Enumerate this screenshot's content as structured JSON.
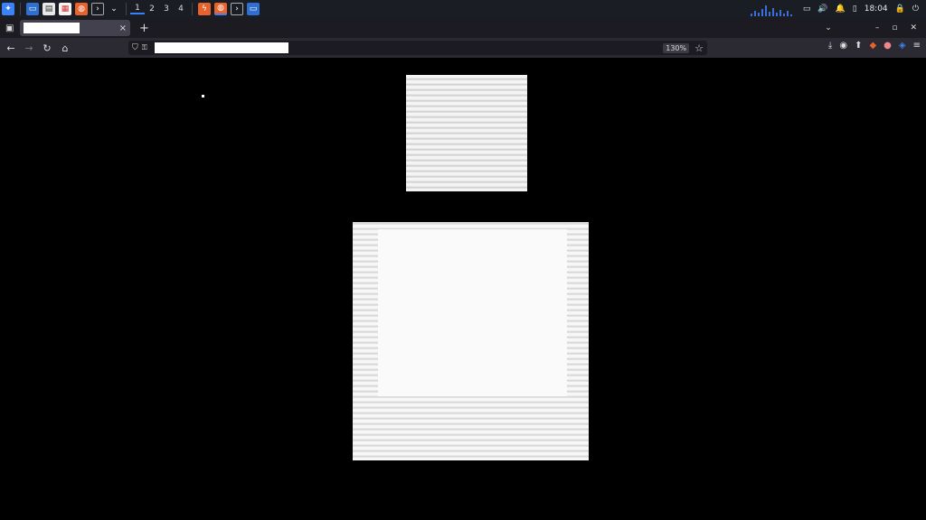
{
  "taskbar": {
    "workspaces": [
      "1",
      "2",
      "3",
      "4"
    ],
    "clock": "18:04"
  },
  "browser": {
    "tab_close": "×",
    "new_tab": "+",
    "zoom": "130%"
  },
  "icons": {
    "back": "←",
    "forward": "→",
    "reload": "↻",
    "home": "⌂",
    "shield": "⛉",
    "lock": "🔒",
    "star": "☆",
    "download": "⤓",
    "account": "◉",
    "extensions": "⬆",
    "menu": "≡"
  }
}
